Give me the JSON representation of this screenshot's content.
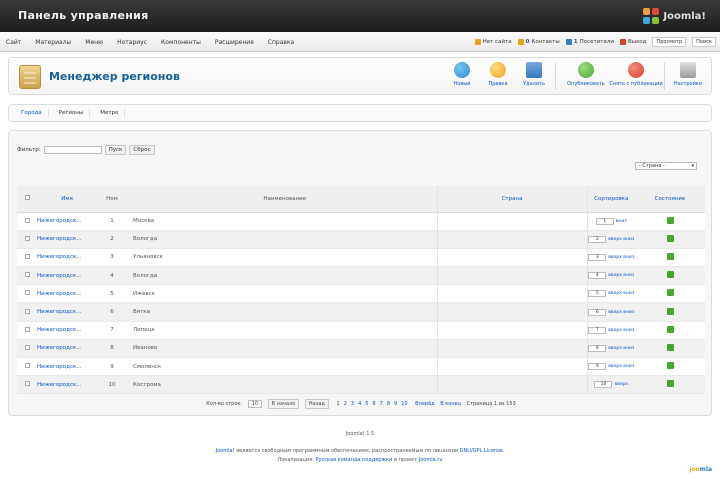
{
  "header": {
    "title": "Панель управления",
    "logo_text": "Joomla!"
  },
  "menubar": {
    "items": [
      "Сайт",
      "Материалы",
      "Меню",
      "Нотариус",
      "Компоненты",
      "Расширения",
      "Справка"
    ],
    "status": [
      {
        "label": "Нет сайта",
        "color": "#e3a31c"
      },
      {
        "num": "0",
        "label": "Контакты",
        "color": "#e3a31c"
      },
      {
        "num": "1",
        "label": "Посетители",
        "color": "#3b7dc3"
      },
      {
        "label": "Выход",
        "color": "#d84130"
      }
    ],
    "preview_label": "Просмотр",
    "search_label": "Поиск"
  },
  "toolbar": {
    "page_title": "Менеджер регионов",
    "buttons": [
      {
        "label": "Новый",
        "color": "#2a8ed0",
        "icon": "new-icon"
      },
      {
        "label": "Правка",
        "color": "#f1a52b",
        "icon": "edit-icon"
      },
      {
        "label": "Удалить",
        "color": "#3579bd",
        "icon": "delete-icon"
      },
      {
        "label": "Опубликовать",
        "color": "#4aa632",
        "icon": "publish-icon"
      },
      {
        "label": "Снять с публикации",
        "color": "#d8402f",
        "icon": "unpublish-icon"
      },
      {
        "label": "Настройки",
        "color": "#9a9a9a",
        "icon": "settings-icon"
      }
    ]
  },
  "submenu": {
    "tabs": [
      "Города",
      "Регионы",
      "Метро"
    ]
  },
  "filter": {
    "label": "Фильтр:",
    "go_label": "Пуск",
    "reset_label": "Сброс",
    "select_value": "- Страна -"
  },
  "table": {
    "headers": {
      "name": "Имя",
      "num": "Ном",
      "title": "Наименование",
      "date": "Страна",
      "order": "Сортировка",
      "status": "Состояние"
    },
    "rows": [
      {
        "name": "Нижегородск...",
        "num": "1",
        "title": "Москва",
        "order_value": "1",
        "order_link": "вниз"
      },
      {
        "name": "Нижегородск...",
        "num": "2",
        "title": "Вологда",
        "order_value": "2",
        "order_link": "вверх вниз"
      },
      {
        "name": "Нижегородск...",
        "num": "3",
        "title": "Ульяновск",
        "order_value": "3",
        "order_link": "вверх вниз"
      },
      {
        "name": "Нижегородск...",
        "num": "4",
        "title": "Вологда",
        "order_value": "4",
        "order_link": "вверх вниз"
      },
      {
        "name": "Нижегородск...",
        "num": "5",
        "title": "Ижевск",
        "order_value": "5",
        "order_link": "вверх вниз"
      },
      {
        "name": "Нижегородск...",
        "num": "6",
        "title": "Вятка",
        "order_value": "6",
        "order_link": "вверх вниз"
      },
      {
        "name": "Нижегородск...",
        "num": "7",
        "title": "Липецк",
        "order_value": "7",
        "order_link": "вверх вниз"
      },
      {
        "name": "Нижегородск...",
        "num": "8",
        "title": "Иваново",
        "order_value": "8",
        "order_link": "вверх вниз"
      },
      {
        "name": "Нижегородск...",
        "num": "9",
        "title": "Смоленск",
        "order_value": "9",
        "order_link": "вверх вниз"
      },
      {
        "name": "Нижегородск...",
        "num": "10",
        "title": "Кострома",
        "order_value": "10",
        "order_link": "вверх"
      }
    ]
  },
  "pagination": {
    "display_label": "Кол-во строк:",
    "display_value": "10",
    "start_label": "В начало",
    "prev_label": "Назад",
    "pages": [
      "1",
      "2",
      "3",
      "4",
      "5",
      "6",
      "7",
      "8",
      "9",
      "10"
    ],
    "next_label": "Вперёд",
    "end_label": "В конец",
    "page_info": "Страница 1 из 153"
  },
  "footer": {
    "version": "Joomla! 1.5",
    "line1_link": "Joomla!",
    "line1_text": "является свободным программным обеспечением, распространяемым по лицензии",
    "line1_link2": "GNU/GPL License.",
    "line2_label": "Локализация:",
    "line2_link1": "Русская команда поддержки",
    "line2_text": "и проект",
    "line2_link2": "Joomla.ru"
  }
}
